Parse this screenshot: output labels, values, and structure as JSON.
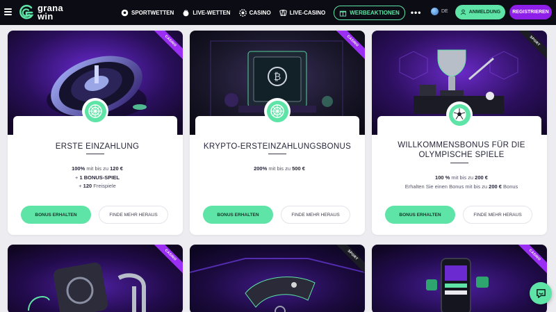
{
  "brand": {
    "line1": "grana",
    "line2": "win"
  },
  "nav": {
    "items": [
      {
        "label": "SPORTWETTEN",
        "icon": "soccer-ball-icon"
      },
      {
        "label": "LIVE-WETTEN",
        "icon": "live-icon"
      },
      {
        "label": "CASINO",
        "icon": "chip-icon"
      },
      {
        "label": "LIVE-CASINO",
        "icon": "cards-icon"
      }
    ],
    "promo": {
      "label": "WERBEAKTIONEN",
      "icon": "gift-icon"
    },
    "more": "•••"
  },
  "language": {
    "code": "DE"
  },
  "auth": {
    "login_label": "ANMELDUNG",
    "register_label": "REGISTRIEREN"
  },
  "colors": {
    "accent": "#5ee4a6",
    "purple": "#8e1fe8",
    "header_bg": "#0c0c14"
  },
  "promotions": [
    {
      "badge": "CASINO",
      "icon": "roulette-wheel-icon",
      "title": "ERSTE EINZAHLUNG",
      "lines": [
        {
          "strong": "100%",
          "text": " mit bis zu ",
          "strong2": "120 €"
        },
        {
          "strong": "",
          "text": "+ ",
          "strong2": "1 BONUS-SPIEL"
        },
        {
          "strong": "",
          "text": "+ ",
          "strong2": "120",
          "text2": " Freispiele"
        }
      ],
      "cta_label": "BONUS ERHALTEN",
      "more_label": "FINDE MEHR HERAUS"
    },
    {
      "badge": "CASINO",
      "icon": "roulette-wheel-icon",
      "title": "KRYPTO-ERSTEINZAHLUNGSBONUS",
      "lines": [
        {
          "strong": "200%",
          "text": " mit bis zu ",
          "strong2": "500 €"
        }
      ],
      "cta_label": "BONUS ERHALTEN",
      "more_label": "FINDE MEHR HERAUS"
    },
    {
      "badge": "SPORT",
      "icon": "soccer-ball-icon",
      "title_line1": "WILLKOMMENSBONUS FÜR DIE",
      "title_line2": "OLYMPISCHE SPIELE",
      "lines": [
        {
          "strong": "100 %",
          "text": " mit bis zu ",
          "strong2": "200 €"
        },
        {
          "strong": "",
          "text": "Erhalten Sie einen Bonus mit bis zu ",
          "strong2": "200 €",
          "text2": " Bonus"
        }
      ],
      "cta_label": "BONUS ERHALTEN",
      "more_label": "FINDE MEHR HERAUS"
    },
    {
      "badge": "CASINO"
    },
    {
      "badge": "SPORT"
    },
    {
      "badge": "CASINO"
    }
  ]
}
